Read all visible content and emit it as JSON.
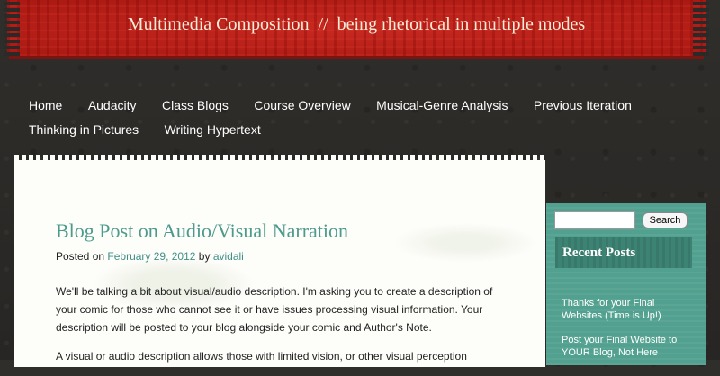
{
  "site": {
    "title": "Multimedia Composition",
    "separator": "//",
    "tagline": "being rhetorical in multiple modes"
  },
  "nav": {
    "items": [
      {
        "label": "Home"
      },
      {
        "label": "Audacity"
      },
      {
        "label": "Class Blogs"
      },
      {
        "label": "Course Overview"
      },
      {
        "label": "Musical-Genre Analysis"
      },
      {
        "label": "Previous Iteration"
      },
      {
        "label": "Thinking in Pictures"
      },
      {
        "label": "Writing Hypertext"
      }
    ]
  },
  "post": {
    "title": "Blog Post on Audio/Visual Narration",
    "posted_on_prefix": "Posted on",
    "date": "February 29, 2012",
    "by_prefix": "by",
    "author": "avidali",
    "paragraphs": [
      "We'll be talking a bit about visual/audio description. I'm asking you to create a description of your comic for those who cannot see it or have issues processing visual information. Your description will be posted to your blog alongside your comic and Author's Note.",
      "A visual or audio description allows those with limited vision, or other visual perception"
    ]
  },
  "sidebar": {
    "search_placeholder": "",
    "search_button": "Search",
    "recent_title": "Recent Posts",
    "recent_posts": [
      {
        "label": "Thanks for your Final Websites (Time is Up!)"
      },
      {
        "label": "Post your Final Website to YOUR Blog, Not Here"
      }
    ]
  },
  "colors": {
    "banner": "#c2231c",
    "background": "#2b2a28",
    "accent_teal": "#4c9a8c",
    "sidebar": "#52a08f"
  }
}
